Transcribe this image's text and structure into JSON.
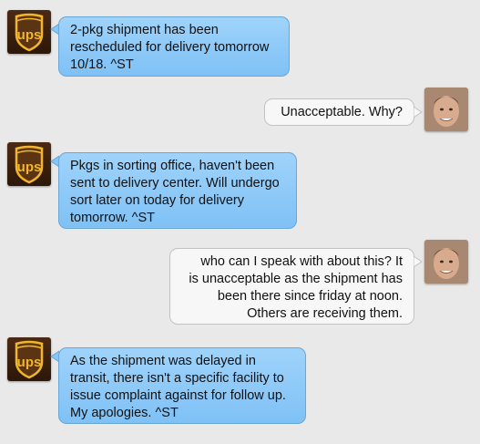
{
  "conversation": {
    "brand_color": "#5a3413",
    "incoming_bubble_color": "#8ccaf8",
    "outgoing_bubble_color": "#f7f7f7",
    "messages": [
      {
        "sender": "ups",
        "avatar_icon": "ups-logo-icon",
        "avatar_text": "ups",
        "lines": [
          "2-pkg shipment has been",
          "rescheduled for delivery tomorrow",
          "10/18. ^ST"
        ]
      },
      {
        "sender": "user",
        "avatar_icon": "user-photo-avatar",
        "lines": [
          "Unacceptable.  Why?"
        ]
      },
      {
        "sender": "ups",
        "avatar_icon": "ups-logo-icon",
        "avatar_text": "ups",
        "lines": [
          "Pkgs in sorting office, haven't been",
          "sent to delivery center. Will undergo",
          "sort later on today for delivery",
          "tomorrow. ^ST"
        ]
      },
      {
        "sender": "user",
        "avatar_icon": "user-photo-avatar",
        "lines": [
          "who can I speak with about this?  It",
          "is unacceptable as the shipment has",
          "been there since friday at noon.",
          "Others are receiving them."
        ]
      },
      {
        "sender": "ups",
        "avatar_icon": "ups-logo-icon",
        "avatar_text": "ups",
        "lines": [
          "As the shipment was delayed in",
          "transit, there isn't a specific facility to",
          "issue complaint against for follow up.",
          "My apologies. ^ST"
        ]
      }
    ]
  }
}
